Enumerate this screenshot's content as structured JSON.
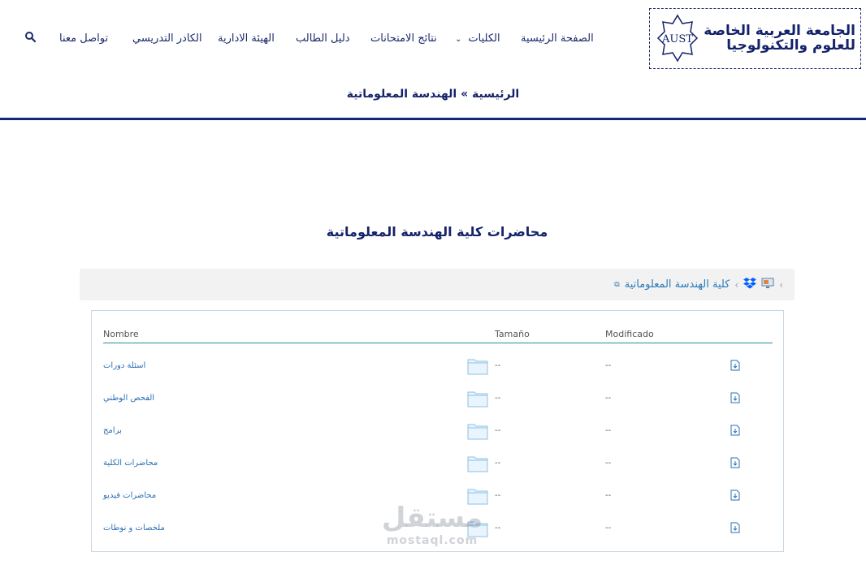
{
  "logo": {
    "line1": "الجامعة العربية الخاصة",
    "line2": "للعلوم والتكنولوجيا",
    "seal": "AUST"
  },
  "nav": {
    "home": "الصفحة الرئيسية",
    "faculties": "الكليات",
    "results": "نتائج الامتحانات",
    "student_guide": "دليل الطالب",
    "admin_staff": "الهيئة الادارية",
    "teaching_staff": "الكادر التدريسي",
    "contact": "تواصل معنا"
  },
  "breadcrumb": "الرئيسية » الهندسة المعلوماتية",
  "page_title": "محاضرات كلية الهندسة المعلوماتية",
  "browser": {
    "path_label": "كلية الهندسة المعلوماتية",
    "columns": {
      "name": "Nombre",
      "size": "Tamaño",
      "modified": "Modificado"
    },
    "rows": [
      {
        "name": "اسئلة دورات",
        "size": "--",
        "modified": "--"
      },
      {
        "name": "الفحص الوطني",
        "size": "--",
        "modified": "--"
      },
      {
        "name": "برامج",
        "size": "--",
        "modified": "--"
      },
      {
        "name": "محاضرات الكلية",
        "size": "--",
        "modified": "--"
      },
      {
        "name": "محاضرات فيديو",
        "size": "--",
        "modified": "--"
      },
      {
        "name": "ملخصات و نوطات",
        "size": "--",
        "modified": "--"
      }
    ]
  },
  "watermark": {
    "arabic": "مستقل",
    "latin": "mostaql.com"
  },
  "colors": {
    "primary": "#14226a",
    "rule": "#142680",
    "link": "#2b7bb9",
    "folder": "#a9d4f0"
  }
}
